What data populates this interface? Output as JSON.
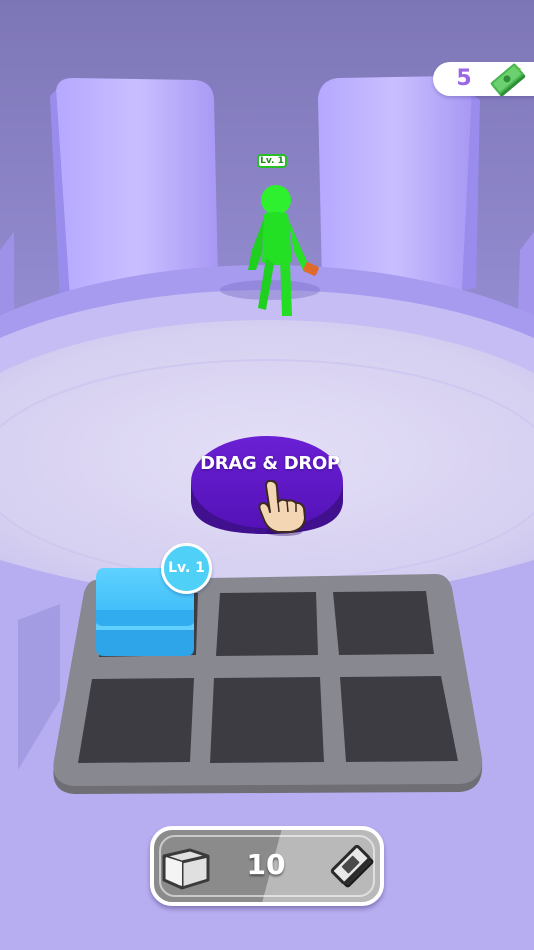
{
  "hud": {
    "money": "5",
    "money_icon": "cash-stack-icon"
  },
  "enemy": {
    "level_label": "Lv. 1",
    "color": "#22e022"
  },
  "tutorial": {
    "drag_label": "DRAG & DROP",
    "pad_color": "#5a17c4",
    "hand_icon": "pointing-hand-icon"
  },
  "board": {
    "slots_total": 6,
    "unit": {
      "level_label": "Lv. 1",
      "color": "#35b8f5"
    }
  },
  "buy_button": {
    "count": "10",
    "left_icon": "crate-icon",
    "right_icon": "cash-stack-icon"
  },
  "colors": {
    "arena_floor": "#d8d2f2",
    "arena_wall": "#a99cf2",
    "board_frame": "#7d7d82",
    "board_slot": "#3d3c43"
  }
}
